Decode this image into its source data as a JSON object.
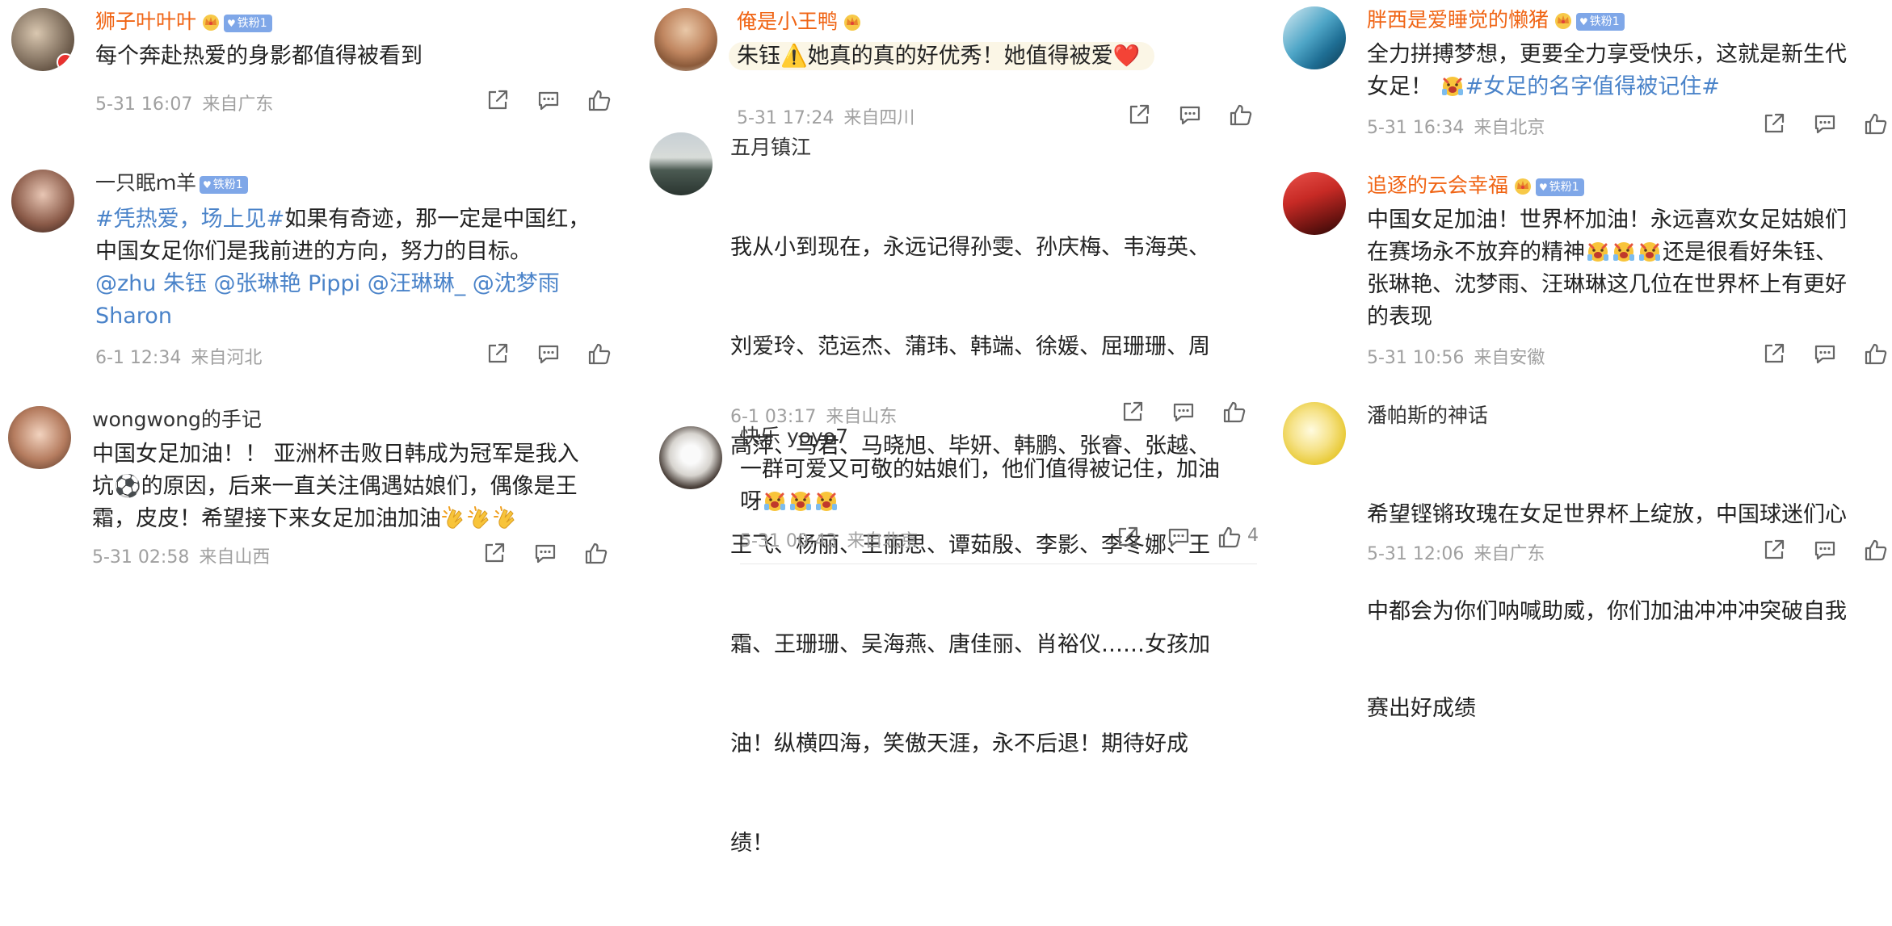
{
  "comments": [
    {
      "username": "狮子叶叶叶",
      "fan_badge": "铁粉1",
      "text": "每个奔赴热爱的身影都值得被看到",
      "date": "5-31 16:07",
      "location": "来自广东"
    },
    {
      "username": "一只眠ｍ羊",
      "fan_badge": "铁粉1",
      "text_hashtag": "#凭热爱，场上见#",
      "text_line1": "如果有奇迹，那一定是中国红，",
      "text_line2": "中国女足你们是我前进的方向，努力的目标。",
      "mentions_line1": "@zhu 朱钰 @张琳艳 Pippi @汪琳琳_ @沈梦雨",
      "mentions_line2": "Sharon",
      "date": "6-1 12:34",
      "location": "来自河北"
    },
    {
      "username": "wongwong的手记",
      "text_line1": "中国女足加油！！ 亚洲杯击败日韩成为冠军是我入",
      "text_line2": "坑⚽的原因，后来一直关注偶遇姑娘们，偶像是王",
      "text_line3": "霜，皮皮！希望接下来女足加油加油",
      "date": "5-31 02:58",
      "location": "来自山西"
    },
    {
      "username": "俺是小王鸭",
      "text": "朱钰⚠️她真的真的好优秀！她值得被爱❤️",
      "date": "5-31 17:24",
      "location": "来自四川"
    },
    {
      "username": "五月镇江",
      "lines": [
        "我从小到现在，永远记得孙雯、孙庆梅、韦海英、",
        "刘爱玲、范运杰、蒲玮、韩端、徐媛、屈珊珊、周",
        "高萍、马君、马晓旭、毕妍、韩鹏、张睿、张越、",
        "王飞、杨丽、王丽思、谭茹殷、李影、李冬娜、王",
        "霜、王珊珊、吴海燕、唐佳丽、肖裕仪……女孩加",
        "油！纵横四海，笑傲天涯，永不后退！期待好成",
        "绩！"
      ],
      "date": "6-1 03:17",
      "location": "来自山东"
    },
    {
      "username": "快乐 yoyo7",
      "text_line1": "一群可爱又可敬的姑娘们，他们值得被记住，加油",
      "text_line2": "呀",
      "date": "5-31 00:43",
      "location": "来自北京",
      "like_count": "4"
    },
    {
      "username": "胖西是爱睡觉的懒猪",
      "fan_badge": "铁粉1",
      "text_line1": "全力拼搏梦想，更要全力享受快乐，这就是新生代",
      "text_line2_prefix": "女足！",
      "text_hashtag": "#女足的名字值得被记住#",
      "date": "5-31 16:34",
      "location": "来自北京"
    },
    {
      "username": "追逐的云会幸福",
      "fan_badge": "铁粉1",
      "text_line1": "中国女足加油！世界杯加油！永远喜欢女足姑娘们",
      "text_line2_a": "在赛场永不放弃的精神",
      "text_line2_b": "还是很看好朱钰、",
      "text_line3": "张琳艳、沈梦雨、汪琳琳这几位在世界杯上有更好",
      "text_line4": "的表现",
      "date": "5-31 10:56",
      "location": "来自安徽"
    },
    {
      "username": "潘帕斯的神话",
      "lines": [
        "希望铿锵玫瑰在女足世界杯上绽放，中国球迷们心",
        "中都会为你们呐喊助威，你们加油冲冲冲突破自我",
        "赛出好成绩"
      ],
      "date": "5-31 12:06",
      "location": "来自广东"
    }
  ],
  "icons": {
    "share": "share-icon",
    "comment": "comment-icon",
    "like": "like-icon"
  },
  "colors": {
    "username_highlight": "#f06414",
    "link": "#4a83c9",
    "meta": "#a0a0a0",
    "fan_badge_bg": "#7fa7e8"
  }
}
